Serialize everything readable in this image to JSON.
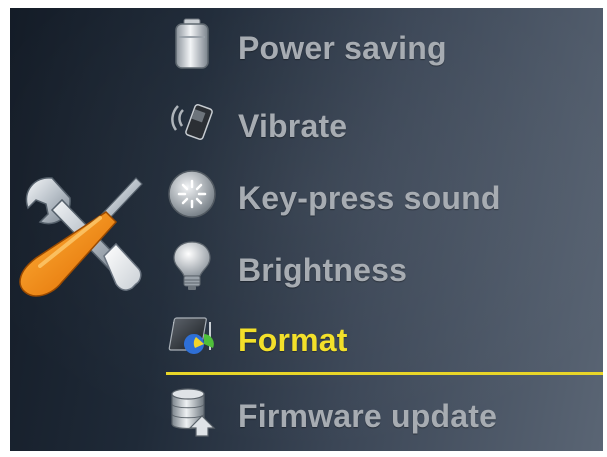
{
  "menu": {
    "items": [
      {
        "label": "Power saving",
        "icon": "battery-icon"
      },
      {
        "label": "Vibrate",
        "icon": "vibrate-icon"
      },
      {
        "label": "Key-press sound",
        "icon": "key-sound-icon"
      },
      {
        "label": "Brightness",
        "icon": "lightbulb-icon"
      },
      {
        "label": "Format",
        "icon": "chip-format-icon",
        "selected": true
      },
      {
        "label": "Firmware update",
        "icon": "database-update-icon"
      }
    ]
  },
  "colors": {
    "label": "#a7acb2",
    "selected_label": "#f3e02a",
    "underline": "#e9d628"
  },
  "settings_icon": "wrench-screwdriver-icon"
}
